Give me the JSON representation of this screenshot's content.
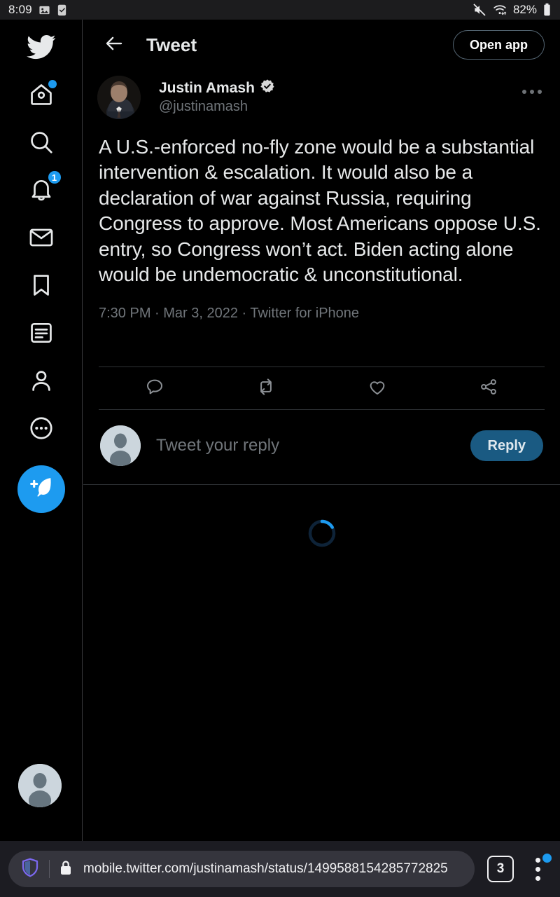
{
  "status_bar": {
    "time": "8:09",
    "battery_percent": "82%",
    "icons": [
      "image-icon",
      "checkbox-icon",
      "mute-icon",
      "wifi-icon",
      "battery-icon"
    ]
  },
  "sidebar": {
    "items": [
      {
        "name": "twitter-logo",
        "label": "Twitter"
      },
      {
        "name": "home",
        "label": "Home",
        "badge_dot": true
      },
      {
        "name": "search",
        "label": "Search"
      },
      {
        "name": "notifications",
        "label": "Notifications",
        "badge_count": "1"
      },
      {
        "name": "messages",
        "label": "Messages"
      },
      {
        "name": "bookmarks",
        "label": "Bookmarks"
      },
      {
        "name": "lists",
        "label": "Lists"
      },
      {
        "name": "profile",
        "label": "Profile"
      },
      {
        "name": "more",
        "label": "More"
      }
    ],
    "compose_label": "Tweet",
    "account_avatar_label": "Account"
  },
  "header": {
    "back_label": "Back",
    "title": "Tweet",
    "open_app_label": "Open app"
  },
  "tweet": {
    "display_name": "Justin Amash",
    "verified": true,
    "handle": "@justinamash",
    "body": "A U.S.-enforced no-fly zone would be a substantial intervention & escalation. It would also be a declaration of war against Russia, requiring Congress to approve. Most Americans oppose U.S. entry, so Congress won’t act. Biden acting alone would be undemocratic & unconstitutional.",
    "timestamp": "7:30 PM · Mar 3, 2022 · Twitter for iPhone",
    "actions": [
      {
        "name": "reply-action",
        "label": "Reply"
      },
      {
        "name": "retweet-action",
        "label": "Retweet"
      },
      {
        "name": "like-action",
        "label": "Like"
      },
      {
        "name": "share-action",
        "label": "Share"
      }
    ],
    "more_label": "More"
  },
  "reply_composer": {
    "placeholder": "Tweet your reply",
    "button_label": "Reply"
  },
  "loading": {
    "label": "Loading replies"
  },
  "browser": {
    "url": "mobile.twitter.com/justinamash/status/1499588154285772825",
    "tab_count": "3",
    "shield_label": "Brave Shields",
    "lock_label": "Secure",
    "menu_label": "More options"
  },
  "colors": {
    "accent": "#1d9bf0",
    "background": "#000000",
    "text_primary": "#e7e9ea",
    "text_secondary": "#71767b",
    "divider": "#2f3336",
    "reply_button": "#1a5a82",
    "browser_bar": "#1c1c22"
  }
}
